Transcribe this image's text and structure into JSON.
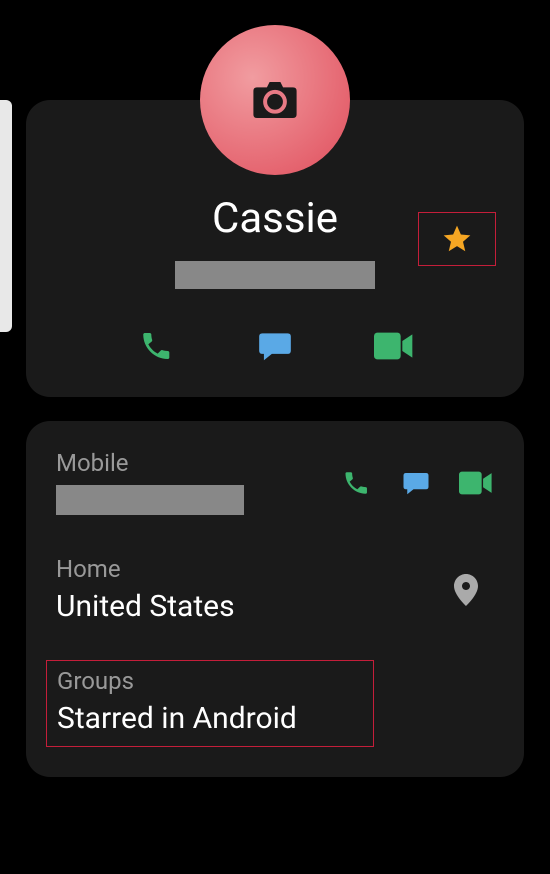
{
  "contact": {
    "name": "Cassie",
    "mobile_label": "Mobile",
    "home_label": "Home",
    "home_value": "United States",
    "groups_label": "Groups",
    "groups_value": "Starred in Android"
  }
}
